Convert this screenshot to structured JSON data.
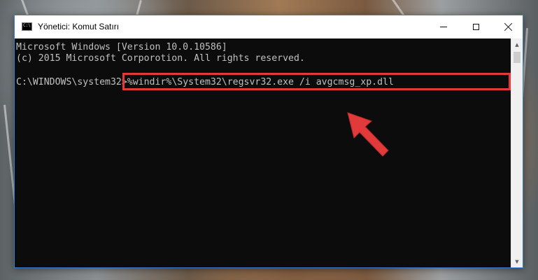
{
  "window": {
    "title": "Yönetici: Komut Satırı",
    "icon": "cmd-icon",
    "icon_glyph": "C:\\"
  },
  "controls": {
    "minimize_icon": "minimize-icon",
    "maximize_icon": "maximize-icon",
    "close_icon": "close-icon"
  },
  "console": {
    "lines": [
      "Microsoft Windows [Version 10.0.10586]",
      "(c) 2015 Microsoft Corporotion. All rights reserved."
    ],
    "prompt": "C:\\WINDOWS\\system32>",
    "command": "%windir%\\System32\\regsvr32.exe /i avgcmsg_xp.dll"
  },
  "annotation": {
    "highlight_color": "#e03a3a",
    "arrow_color": "#e03a3a"
  },
  "scrollbar": {
    "up_icon": "scroll-up-icon",
    "down_icon": "scroll-down-icon"
  }
}
